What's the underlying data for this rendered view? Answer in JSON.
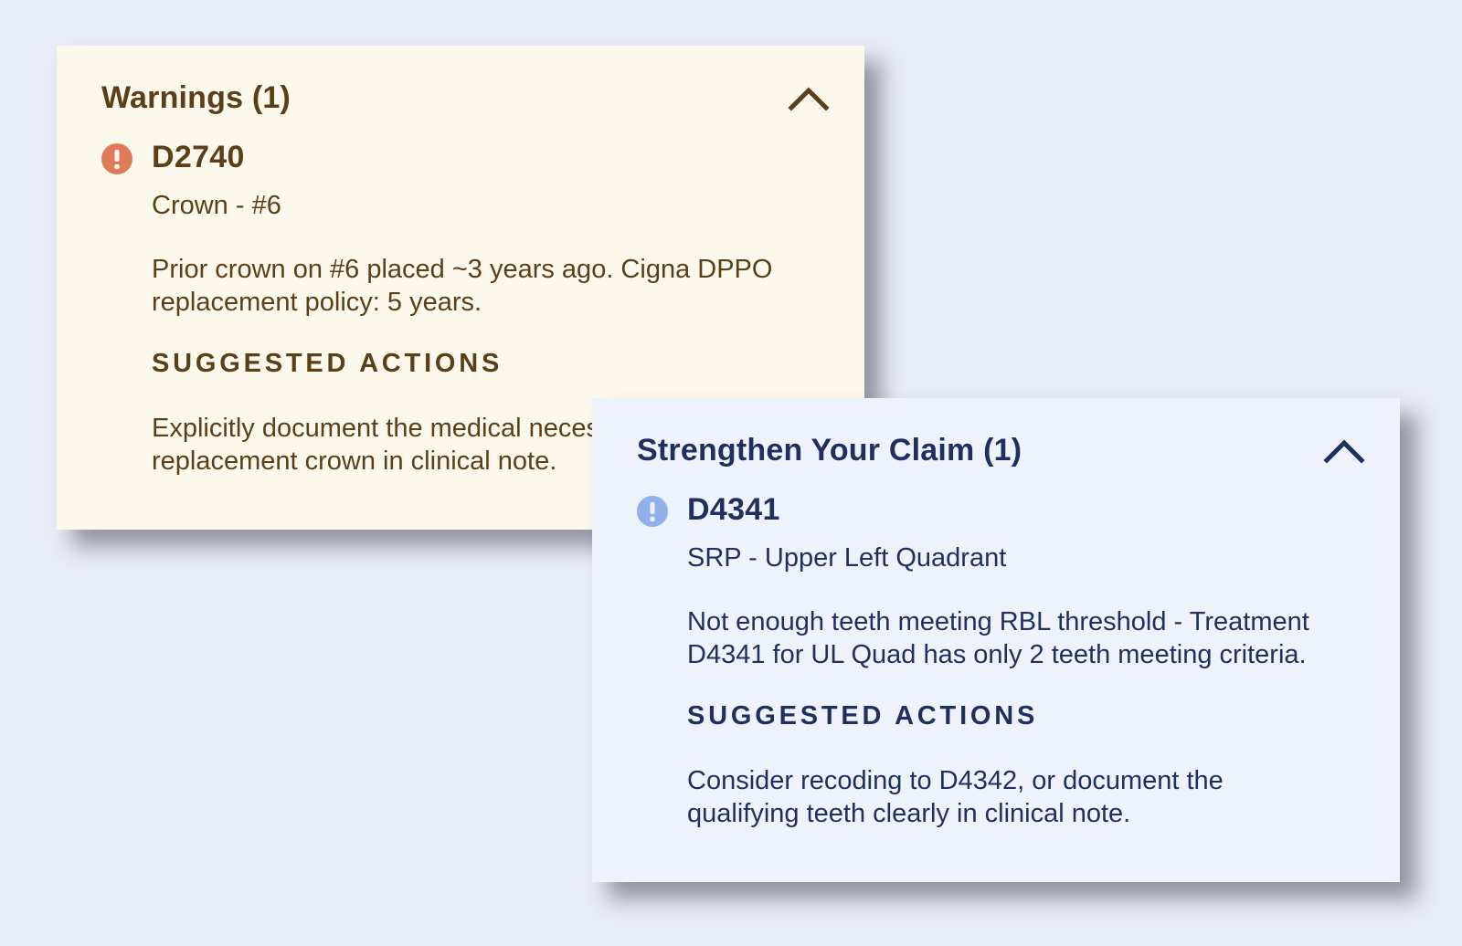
{
  "warnings_card": {
    "title": "Warnings (1)",
    "code": "D2740",
    "subtitle": "Crown - #6",
    "description_line1": "Prior crown on #6 placed ~3 years ago. Cigna DPPO",
    "description_line2": "replacement policy: 5 years.",
    "section_label": "SUGGESTED ACTIONS",
    "action_line1": "Explicitly document the medical necessity for",
    "action_line2": "replacement crown in clinical note.",
    "icon": "exclamation-circle-icon",
    "icon_color": "#e07b5a",
    "text_color": "#5a3f18",
    "background": "#fcf8ec"
  },
  "claim_card": {
    "title": "Strengthen Your Claim (1)",
    "code": "D4341",
    "subtitle": "SRP - Upper Left Quadrant",
    "description_line1": "Not enough teeth meeting RBL threshold - Treatment",
    "description_line2": "D4341 for UL Quad has only 2 teeth meeting criteria.",
    "section_label": "SUGGESTED ACTIONS",
    "action_line1": "Consider recoding to D4342, or document the",
    "action_line2": "qualifying teeth clearly in clinical note.",
    "icon": "info-exclamation-circle-icon",
    "icon_color": "#8fb0ea",
    "text_color": "#1f2f5e",
    "background": "#eef2fb"
  },
  "page_background": "#e8ecf6"
}
